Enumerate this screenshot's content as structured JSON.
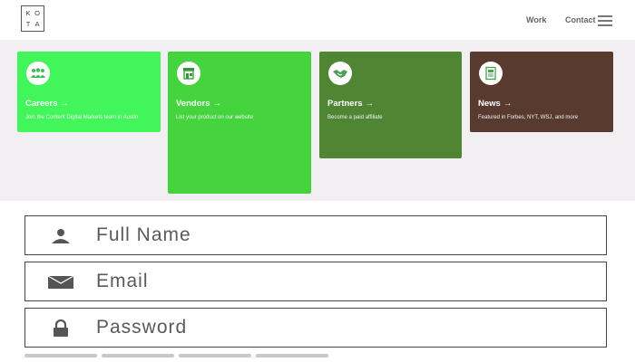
{
  "header": {
    "logo_letters": [
      "K",
      "O",
      "T",
      "A"
    ],
    "nav": {
      "work": "Work",
      "contact": "Contact"
    }
  },
  "cards": [
    {
      "title": "Careers",
      "desc": "Join the Content Digital Markets team in Austin",
      "color": "#41f55a",
      "icon": "people-icon"
    },
    {
      "title": "Vendors",
      "desc": "List your product on our website",
      "color": "#45d43e",
      "icon": "storefront-icon"
    },
    {
      "title": "Partners",
      "desc": "Become a paid affiliate",
      "color": "#508534",
      "icon": "handshake-icon"
    },
    {
      "title": "News",
      "desc": "Featured in Forbes, NYT, WSJ, and more",
      "color": "#583a2f",
      "icon": "newspaper-icon"
    }
  ],
  "form": {
    "full_name": {
      "placeholder": "Full Name",
      "value": ""
    },
    "email": {
      "placeholder": "Email",
      "value": ""
    },
    "password": {
      "placeholder": "Password",
      "value": ""
    }
  }
}
